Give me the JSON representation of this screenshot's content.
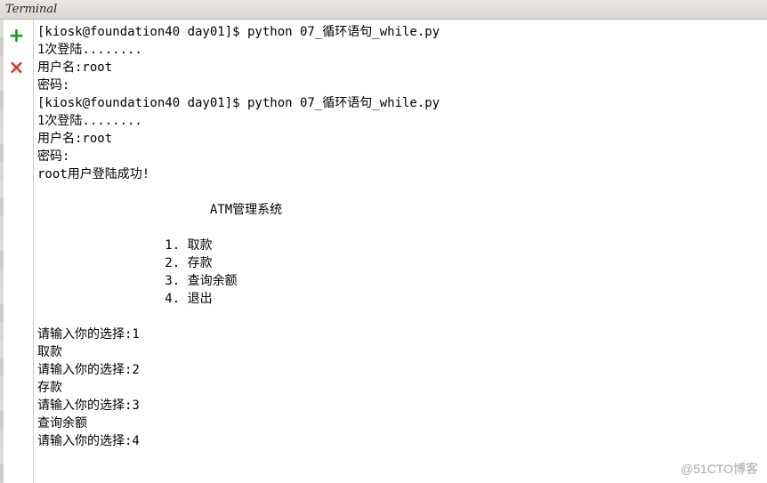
{
  "titlebar": {
    "title": "Terminal"
  },
  "toolbar": {
    "new_tab_icon": "plus-icon",
    "close_tab_icon": "close-icon"
  },
  "terminal": {
    "lines": [
      "[kiosk@foundation40 day01]$ python 07_循环语句_while.py",
      "1次登陆........",
      "用户名:root",
      "密码:",
      "[kiosk@foundation40 day01]$ python 07_循环语句_while.py",
      "1次登陆........",
      "用户名:root",
      "密码:",
      "root用户登陆成功!",
      "",
      "                       ATM管理系统",
      "",
      "                 1. 取款",
      "                 2. 存款",
      "                 3. 查询余额",
      "                 4. 退出",
      "",
      "请输入你的选择:1",
      "取款",
      "请输入你的选择:2",
      "存款",
      "请输入你的选择:3",
      "查询余额",
      "请输入你的选择:4"
    ]
  },
  "watermark": {
    "text": "@51CTO博客"
  }
}
